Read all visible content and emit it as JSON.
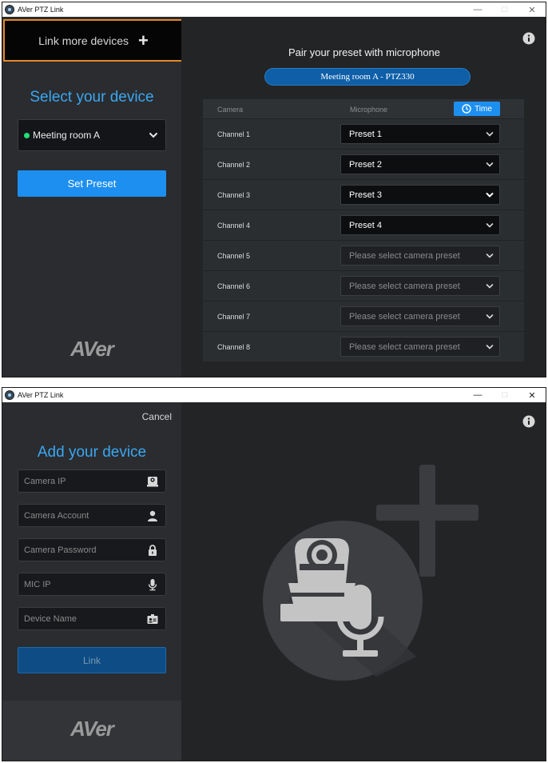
{
  "window1": {
    "title": "AVer PTZ Link",
    "controls": {
      "minimize": "—",
      "maximize": "□",
      "close": "✕"
    },
    "link_more_label": "Link more devices",
    "select_title": "Select your device",
    "selected_device": "Meeting room A",
    "device_status_color": "#23e07a",
    "set_preset_label": "Set Preset",
    "logo_text": "AVer",
    "pair_title": "Pair your preset with microphone",
    "device_pill": "Meeting room A - PTZ330",
    "table": {
      "col_camera": "Camera",
      "col_microphone": "Microphone",
      "time_label": "Time",
      "rows": [
        {
          "channel": "Channel 1",
          "preset": "Preset 1"
        },
        {
          "channel": "Channel 2",
          "preset": "Preset 2"
        },
        {
          "channel": "Channel 3",
          "preset": "Preset 3"
        },
        {
          "channel": "Channel 4",
          "preset": "Preset 4"
        },
        {
          "channel": "Channel 5",
          "preset": "Please select camera preset"
        },
        {
          "channel": "Channel 6",
          "preset": "Please select camera preset"
        },
        {
          "channel": "Channel 7",
          "preset": "Please select camera preset"
        },
        {
          "channel": "Channel 8",
          "preset": "Please select camera preset"
        }
      ]
    }
  },
  "window2": {
    "title": "AVer PTZ Link",
    "controls": {
      "minimize": "—",
      "maximize": "□",
      "close": "✕"
    },
    "cancel_label": "Cancel",
    "add_title": "Add your device",
    "fields": {
      "camera_ip": "Camera IP",
      "camera_account": "Camera Account",
      "camera_password": "Camera Password",
      "mic_ip": "MIC IP",
      "device_name": "Device Name"
    },
    "link_label": "Link",
    "logo_text": "AVer"
  },
  "accent_color": "#1d8ff0",
  "highlight_color": "#e58a26"
}
